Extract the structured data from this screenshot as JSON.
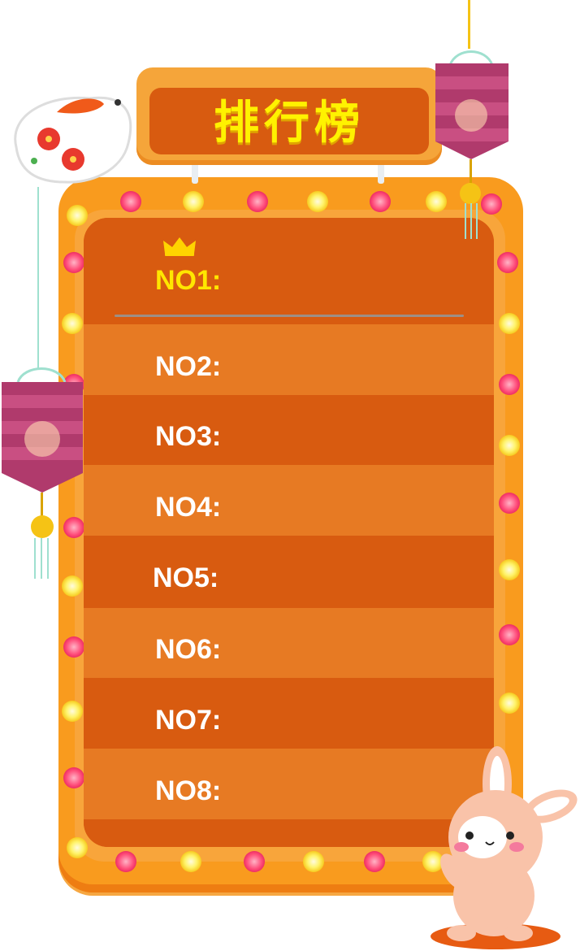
{
  "title": "排行榜",
  "ranks": [
    {
      "label": "NO1:",
      "highlight": true
    },
    {
      "label": "NO2:",
      "highlight": false
    },
    {
      "label": "NO3:",
      "highlight": false
    },
    {
      "label": "NO4:",
      "highlight": false
    },
    {
      "label": "NO5:",
      "highlight": false
    },
    {
      "label": "NO6:",
      "highlight": false
    },
    {
      "label": "NO7:",
      "highlight": false
    },
    {
      "label": "NO8:",
      "highlight": false
    }
  ],
  "colors": {
    "board": "#f99b1e",
    "panel_dark": "#d85b10",
    "panel_light": "#e77a23",
    "title_text": "#fff200",
    "top_rank_text": "#ffe600",
    "rank_text": "#ffffff"
  },
  "icons": [
    "crown-icon",
    "lantern-icon",
    "rabbit-icon",
    "rabbit-mascot-icon"
  ]
}
